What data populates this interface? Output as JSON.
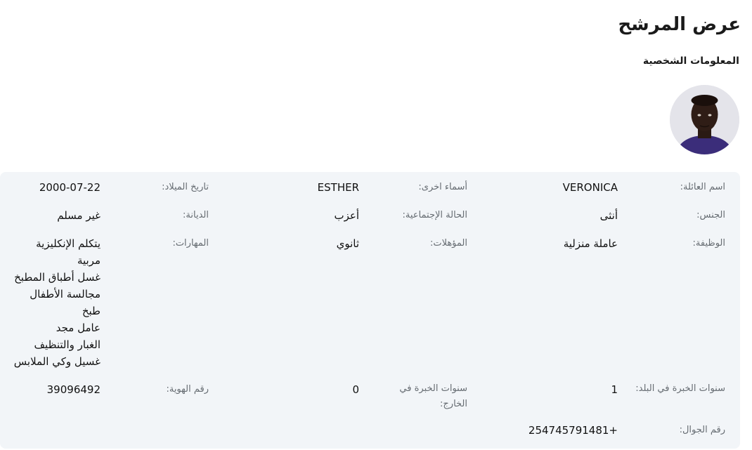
{
  "page": {
    "title": "عرض المرشح",
    "section_title": "المعلومات الشخصية"
  },
  "candidate": {
    "photo_icon": "candidate-photo",
    "family_name": {
      "label": "اسم العائلة:",
      "value": "VERONICA"
    },
    "other_names": {
      "label": "أسماء اخرى:",
      "value": "ESTHER"
    },
    "birth_date": {
      "label": "تاريخ الميلاد:",
      "value": "2000-07-22"
    },
    "gender": {
      "label": "الجنس:",
      "value": "أنثى"
    },
    "marital_status": {
      "label": "الحالة الإجتماعية:",
      "value": "أعزب"
    },
    "religion": {
      "label": "الديانة:",
      "value": "غير مسلم"
    },
    "job": {
      "label": "الوظيفة:",
      "value": "عاملة منزلية"
    },
    "qualifications": {
      "label": "المؤهلات:",
      "value": "ثانوي"
    },
    "skills": {
      "label": "المهارات:",
      "items": [
        "يتكلم الإنكليزية",
        "مربية",
        "غسل أطباق المطبخ",
        "مجالسة الأطفال",
        "طبخ",
        "عامل مجد",
        "الغبار والتنظيف",
        "غسيل وكي الملابس"
      ]
    },
    "local_experience": {
      "label": "سنوات الخبرة في البلد:",
      "value": "1"
    },
    "abroad_experience": {
      "label": "سنوات الخبرة في الخارج:",
      "value": "0"
    },
    "id_number": {
      "label": "رقم الهوية:",
      "value": "39096492"
    },
    "mobile": {
      "label": "رقم الجوال:",
      "value": "254745791481+"
    }
  }
}
